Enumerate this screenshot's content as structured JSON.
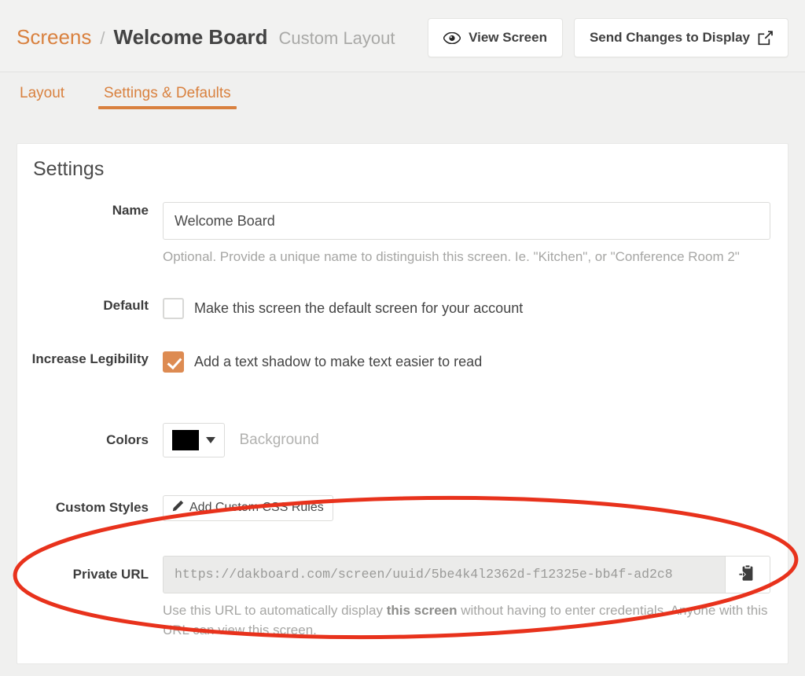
{
  "header": {
    "breadcrumb": {
      "parent": "Screens",
      "separator": "/",
      "current": "Welcome Board",
      "subtitle": "Custom Layout"
    },
    "actions": {
      "view_screen": "View Screen",
      "send_changes": "Send Changes to Display"
    }
  },
  "tabs": [
    {
      "label": "Layout",
      "active": false
    },
    {
      "label": "Settings & Defaults",
      "active": true
    }
  ],
  "card": {
    "title": "Settings",
    "fields": {
      "name": {
        "label": "Name",
        "value": "Welcome Board",
        "placeholder": "",
        "helper": "Optional. Provide a unique name to distinguish this screen. Ie. \"Kitchen\", or \"Conference Room 2\""
      },
      "default": {
        "label": "Default",
        "checkbox_label": "Make this screen the default screen for your account",
        "checked": false
      },
      "legibility": {
        "label": "Increase Legibility",
        "checkbox_label": "Add a text shadow to make text easier to read",
        "checked": true
      },
      "colors": {
        "label": "Colors",
        "swatch_color": "#000000",
        "caption": "Background"
      },
      "custom_styles": {
        "label": "Custom Styles",
        "button_label": "Add Custom CSS Rules"
      },
      "private_url": {
        "label": "Private URL",
        "value": "https://dakboard.com/screen/uuid/5be4k4l2362d-f12325e-bb4f-ad2c8",
        "helper_part1": "Use this URL to automatically display ",
        "helper_bold": "this screen",
        "helper_part2": " without having to enter credentials. Anyone with this URL can view this screen."
      }
    }
  },
  "colors": {
    "accent_orange": "#d9813f",
    "checkbox_orange": "#dd8b52",
    "annotation_red": "#e8321c",
    "page_bg": "#f0f0ef",
    "card_bg": "#ffffff"
  },
  "annotation": {
    "shape": "ellipse",
    "color": "#e8321c"
  }
}
